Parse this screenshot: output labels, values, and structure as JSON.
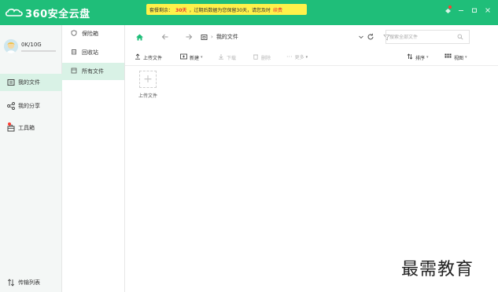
{
  "app": {
    "logo_text": "360安全云盘",
    "brand_color": "#1fbe79",
    "accent_light": "#d9f2e6"
  },
  "notice": {
    "prefix": "套餐剩余：",
    "days": "30天",
    "message": "，过期后数据为您保留30天，请您及时",
    "link": "续费"
  },
  "window_controls": [
    "skin-icon",
    "minimize-icon",
    "maximize-icon",
    "close-icon"
  ],
  "user": {
    "quota": "0K/10G",
    "usage_fraction": 0.0
  },
  "sidebar": {
    "items": [
      {
        "label": "我的文件",
        "icon": "folder-icon",
        "active": true
      },
      {
        "label": "我的分享",
        "icon": "share-icon",
        "active": false
      },
      {
        "label": "工具箱",
        "icon": "toolbox-icon",
        "active": false,
        "badge": true
      }
    ],
    "transfer_label": "传输列表"
  },
  "midnav": {
    "items": [
      {
        "label": "保险箱",
        "icon": "safe-icon",
        "active": false
      },
      {
        "label": "回收站",
        "icon": "recycle-icon",
        "active": false
      },
      {
        "label": "所有文件",
        "icon": "all-files-icon",
        "active": true
      }
    ]
  },
  "addressbar": {
    "current_folder": "我的文件",
    "search_placeholder": "搜索全部文件"
  },
  "toolbar": {
    "upload": "上传文件",
    "new": "新建",
    "download": "下载",
    "delete": "删除",
    "more": "更多",
    "sort": "排序",
    "view": "视图"
  },
  "content": {
    "upload_tile_label": "上传文件"
  },
  "watermark": "最需教育"
}
